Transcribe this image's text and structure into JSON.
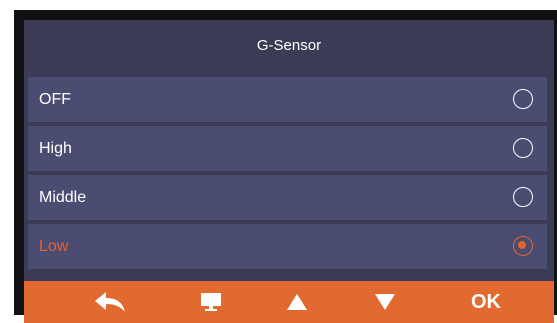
{
  "menu": {
    "title": "G-Sensor",
    "options": [
      {
        "label": "OFF",
        "selected": false
      },
      {
        "label": "High",
        "selected": false
      },
      {
        "label": "Middle",
        "selected": false
      },
      {
        "label": "Low",
        "selected": true
      }
    ]
  },
  "toolbar": {
    "icons": [
      "back-icon",
      "monitor-icon",
      "up-arrow-icon",
      "down-arrow-icon"
    ],
    "ok_label": "OK"
  },
  "colors": {
    "accent": "#e4632c",
    "panel": "#3b3b55",
    "option": "#4a4c72",
    "toolbar": "#e2692f"
  }
}
